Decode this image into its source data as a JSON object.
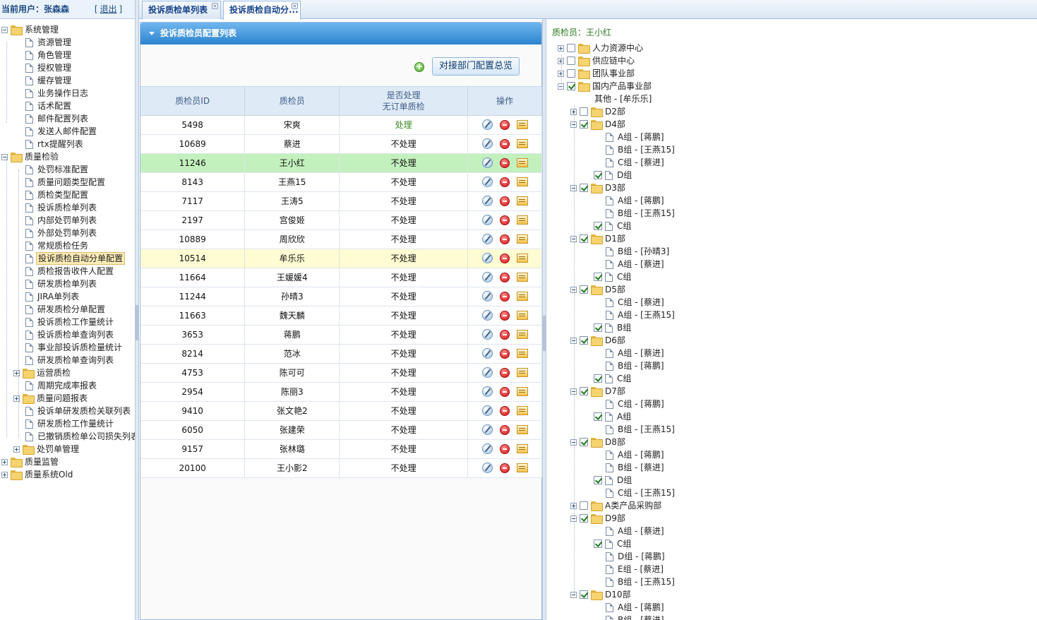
{
  "userbar": {
    "current_user": "当前用户：张森森",
    "logout": "退出"
  },
  "tabs": [
    "投诉质检单列表",
    "投诉质检自动分..."
  ],
  "panel": {
    "title": "投诉质检员配置列表",
    "dept_button": "对接部门配置总览",
    "columns": [
      "质检员ID",
      "质检员",
      "是否处理",
      "无订单质检",
      "操作"
    ],
    "rows": [
      {
        "id": "5498",
        "name": "宋爽",
        "handle": "处理"
      },
      {
        "id": "10689",
        "name": "蔡进",
        "handle": "不处理"
      },
      {
        "id": "11246",
        "name": "王小红",
        "handle": "不处理"
      },
      {
        "id": "8143",
        "name": "王燕15",
        "handle": "不处理"
      },
      {
        "id": "7117",
        "name": "王涛5",
        "handle": "不处理"
      },
      {
        "id": "2197",
        "name": "宫俊姬",
        "handle": "不处理"
      },
      {
        "id": "10889",
        "name": "周欣欣",
        "handle": "不处理"
      },
      {
        "id": "10514",
        "name": "牟乐乐",
        "handle": "不处理"
      },
      {
        "id": "11664",
        "name": "王媛媛4",
        "handle": "不处理"
      },
      {
        "id": "11244",
        "name": "孙晴3",
        "handle": "不处理"
      },
      {
        "id": "11663",
        "name": "魏天麟",
        "handle": "不处理"
      },
      {
        "id": "3653",
        "name": "蒋鹏",
        "handle": "不处理"
      },
      {
        "id": "8214",
        "name": "范冰",
        "handle": "不处理"
      },
      {
        "id": "4753",
        "name": "陈可可",
        "handle": "不处理"
      },
      {
        "id": "2954",
        "name": "陈丽3",
        "handle": "不处理"
      },
      {
        "id": "9410",
        "name": "张文艳2",
        "handle": "不处理"
      },
      {
        "id": "6050",
        "name": "张建荣",
        "handle": "不处理"
      },
      {
        "id": "9157",
        "name": "张林璐",
        "handle": "不处理"
      },
      {
        "id": "20100",
        "name": "王小影2",
        "handle": "不处理"
      }
    ]
  },
  "nav_tree": [
    {
      "label": "系统管理",
      "kind": "folder",
      "level": 0,
      "toggle": "minus"
    },
    {
      "label": "资源管理",
      "kind": "doc",
      "level": 1
    },
    {
      "label": "角色管理",
      "kind": "doc",
      "level": 1
    },
    {
      "label": "授权管理",
      "kind": "doc",
      "level": 1
    },
    {
      "label": "缓存管理",
      "kind": "doc",
      "level": 1
    },
    {
      "label": "业务操作日志",
      "kind": "doc",
      "level": 1
    },
    {
      "label": "话术配置",
      "kind": "doc",
      "level": 1
    },
    {
      "label": "邮件配置列表",
      "kind": "doc",
      "level": 1
    },
    {
      "label": "发送人邮件配置",
      "kind": "doc",
      "level": 1
    },
    {
      "label": "rtx提醒列表",
      "kind": "doc",
      "level": 1
    },
    {
      "label": "质量检验",
      "kind": "folder",
      "level": 0,
      "toggle": "minus"
    },
    {
      "label": "处罚标准配置",
      "kind": "doc",
      "level": 1
    },
    {
      "label": "质量问题类型配置",
      "kind": "doc",
      "level": 1
    },
    {
      "label": "质检类型配置",
      "kind": "doc",
      "level": 1
    },
    {
      "label": "投诉质检单列表",
      "kind": "doc",
      "level": 1
    },
    {
      "label": "内部处罚单列表",
      "kind": "doc",
      "level": 1
    },
    {
      "label": "外部处罚单列表",
      "kind": "doc",
      "level": 1
    },
    {
      "label": "常规质检任务",
      "kind": "doc",
      "level": 1
    },
    {
      "label": "投诉质检自动分单配置",
      "kind": "doc",
      "level": 1,
      "selected": true
    },
    {
      "label": "质检报告收件人配置",
      "kind": "doc",
      "level": 1
    },
    {
      "label": "研发质检单列表",
      "kind": "doc",
      "level": 1
    },
    {
      "label": "JIRA单列表",
      "kind": "doc",
      "level": 1
    },
    {
      "label": "研发质检分单配置",
      "kind": "doc",
      "level": 1
    },
    {
      "label": "投诉质检工作量统计",
      "kind": "doc",
      "level": 1
    },
    {
      "label": "投诉质检单查询列表",
      "kind": "doc",
      "level": 1
    },
    {
      "label": "事业部投诉质检量统计",
      "kind": "doc",
      "level": 1
    },
    {
      "label": "研发质检单查询列表",
      "kind": "doc",
      "level": 1
    },
    {
      "label": "运营质检",
      "kind": "folder",
      "level": 1,
      "toggle": "plus"
    },
    {
      "label": "周期完成率报表",
      "kind": "doc",
      "level": 1
    },
    {
      "label": "质量问题报表",
      "kind": "folder",
      "level": 1,
      "toggle": "plus"
    },
    {
      "label": "投诉单研发质检关联列表",
      "kind": "doc",
      "level": 1
    },
    {
      "label": "研发质检工作量统计",
      "kind": "doc",
      "level": 1
    },
    {
      "label": "已撤销质检单公司损失列表",
      "kind": "doc",
      "level": 1
    },
    {
      "label": "处罚单管理",
      "kind": "folder",
      "level": 1,
      "toggle": "plus"
    },
    {
      "label": "质量监管",
      "kind": "folder",
      "level": 0,
      "toggle": "plus"
    },
    {
      "label": "质量系统Old",
      "kind": "folder",
      "level": 0,
      "toggle": "plus"
    }
  ],
  "right": {
    "inspector": "质检员：王小红",
    "tree": [
      {
        "label": "人力资源中心",
        "level": 0,
        "toggle": "plus",
        "cb": false,
        "kind": "folder"
      },
      {
        "label": "供应链中心",
        "level": 0,
        "toggle": "plus",
        "cb": false,
        "kind": "folder"
      },
      {
        "label": "团队事业部",
        "level": 0,
        "toggle": "plus",
        "cb": false,
        "kind": "folder"
      },
      {
        "label": "国内产品事业部",
        "level": 0,
        "toggle": "minus",
        "cb": true,
        "kind": "folder"
      },
      {
        "label": "其他 - [牟乐乐]",
        "level": 1,
        "kind": "plain"
      },
      {
        "label": "D2部",
        "level": 1,
        "toggle": "plus",
        "cb": false,
        "kind": "folder"
      },
      {
        "label": "D4部",
        "level": 1,
        "toggle": "minus",
        "cb": true,
        "kind": "folder"
      },
      {
        "label": "A组 - [蒋鹏]",
        "level": 2,
        "kind": "doc"
      },
      {
        "label": "B组 - [王燕15]",
        "level": 2,
        "kind": "doc"
      },
      {
        "label": "C组 - [蔡进]",
        "level": 2,
        "kind": "doc"
      },
      {
        "label": "D组",
        "level": 2,
        "cb": true,
        "kind": "doc"
      },
      {
        "label": "D3部",
        "level": 1,
        "toggle": "minus",
        "cb": true,
        "kind": "folder"
      },
      {
        "label": "A组 - [蒋鹏]",
        "level": 2,
        "kind": "doc"
      },
      {
        "label": "B组 - [王燕15]",
        "level": 2,
        "kind": "doc"
      },
      {
        "label": "C组",
        "level": 2,
        "cb": true,
        "kind": "doc"
      },
      {
        "label": "D1部",
        "level": 1,
        "toggle": "minus",
        "cb": true,
        "kind": "folder"
      },
      {
        "label": "B组 - [孙晴3]",
        "level": 2,
        "kind": "doc"
      },
      {
        "label": "A组 - [蔡进]",
        "level": 2,
        "kind": "doc"
      },
      {
        "label": "C组",
        "level": 2,
        "cb": true,
        "kind": "doc"
      },
      {
        "label": "D5部",
        "level": 1,
        "toggle": "minus",
        "cb": true,
        "kind": "folder"
      },
      {
        "label": "C组 - [蔡进]",
        "level": 2,
        "kind": "doc"
      },
      {
        "label": "A组 - [王燕15]",
        "level": 2,
        "kind": "doc"
      },
      {
        "label": "B组",
        "level": 2,
        "cb": true,
        "kind": "doc"
      },
      {
        "label": "D6部",
        "level": 1,
        "toggle": "minus",
        "cb": true,
        "kind": "folder"
      },
      {
        "label": "A组 - [蔡进]",
        "level": 2,
        "kind": "doc"
      },
      {
        "label": "B组 - [蒋鹏]",
        "level": 2,
        "kind": "doc"
      },
      {
        "label": "C组",
        "level": 2,
        "cb": true,
        "kind": "doc"
      },
      {
        "label": "D7部",
        "level": 1,
        "toggle": "minus",
        "cb": true,
        "kind": "folder"
      },
      {
        "label": "C组 - [蒋鹏]",
        "level": 2,
        "kind": "doc"
      },
      {
        "label": "A组",
        "level": 2,
        "cb": true,
        "kind": "doc"
      },
      {
        "label": "B组 - [王燕15]",
        "level": 2,
        "kind": "doc"
      },
      {
        "label": "D8部",
        "level": 1,
        "toggle": "minus",
        "cb": true,
        "kind": "folder"
      },
      {
        "label": "A组 - [蒋鹏]",
        "level": 2,
        "kind": "doc"
      },
      {
        "label": "B组 - [蔡进]",
        "level": 2,
        "kind": "doc"
      },
      {
        "label": "D组",
        "level": 2,
        "cb": true,
        "kind": "doc"
      },
      {
        "label": "C组 - [王燕15]",
        "level": 2,
        "kind": "doc"
      },
      {
        "label": "A类产品采购部",
        "level": 1,
        "toggle": "plus",
        "cb": false,
        "kind": "folder"
      },
      {
        "label": "D9部",
        "level": 1,
        "toggle": "minus",
        "cb": true,
        "kind": "folder"
      },
      {
        "label": "A组 - [蔡进]",
        "level": 2,
        "kind": "doc"
      },
      {
        "label": "C组",
        "level": 2,
        "cb": true,
        "kind": "doc"
      },
      {
        "label": "D组 - [蒋鹏]",
        "level": 2,
        "kind": "doc"
      },
      {
        "label": "E组 - [蔡进]",
        "level": 2,
        "kind": "doc"
      },
      {
        "label": "B组 - [王燕15]",
        "level": 2,
        "kind": "doc"
      },
      {
        "label": "D10部",
        "level": 1,
        "toggle": "minus",
        "cb": true,
        "kind": "folder"
      },
      {
        "label": "A组 - [蒋鹏]",
        "level": 2,
        "kind": "doc"
      },
      {
        "label": "B组 - [蔡进]",
        "level": 2,
        "kind": "doc"
      }
    ]
  }
}
